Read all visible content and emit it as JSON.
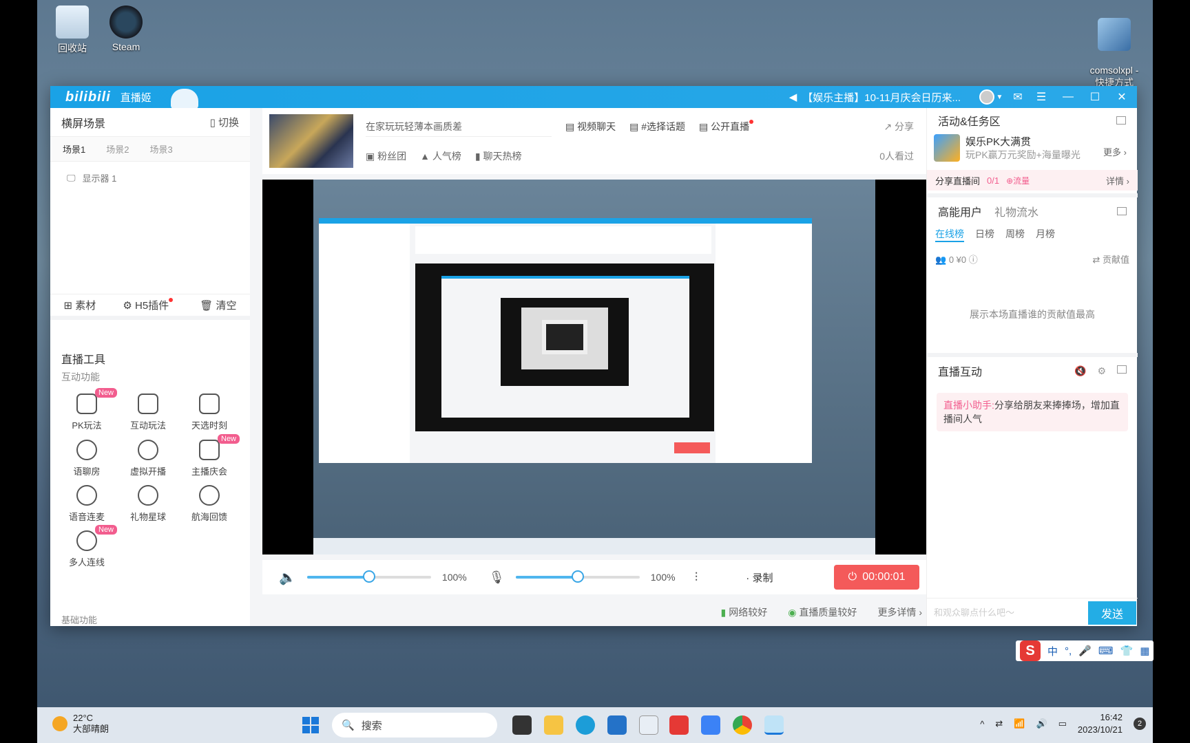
{
  "desktop": {
    "icons": [
      {
        "label": "回收站"
      },
      {
        "label": "Steam"
      },
      {
        "label": "comsolxpl -\n快捷方式"
      }
    ]
  },
  "titlebar": {
    "logo": "bilibili",
    "app_name": "直播姬",
    "notice": "【娱乐主播】10-11月庆会日历来...",
    "minimize": "—",
    "maximize": "☐",
    "close": "✕"
  },
  "left": {
    "scene_header": "横屏场景",
    "switch_label": "切换",
    "scene_tabs": [
      "场景1",
      "场景2",
      "场景3"
    ],
    "source_item": "显示器 1",
    "material_label": "素材",
    "h5_label": "H5插件",
    "clear_label": "清空",
    "tools_title": "直播工具",
    "interact_title": "互动功能",
    "tools": [
      {
        "label": "PK玩法",
        "new": "New"
      },
      {
        "label": "互动玩法",
        "new": ""
      },
      {
        "label": "天选时刻",
        "new": ""
      },
      {
        "label": "语聊房",
        "new": ""
      },
      {
        "label": "虚拟开播",
        "new": ""
      },
      {
        "label": "主播庆会",
        "new": "New"
      },
      {
        "label": "语音连麦",
        "new": ""
      },
      {
        "label": "礼物星球",
        "new": ""
      },
      {
        "label": "航海回馈",
        "new": ""
      },
      {
        "label": "多人连线",
        "new": "New"
      }
    ],
    "basic_title": "基础功能"
  },
  "center": {
    "room_title": "在家玩玩轻薄本画质差",
    "category": "视频聊天",
    "topic": "#选择话题",
    "public_live": "公开直播",
    "share": "分享",
    "fan_group": "粉丝团",
    "popularity": "人气榜",
    "chat_hot": "聊天热榜",
    "viewers": "0人看过",
    "speaker_pct": "100%",
    "mic_pct": "100%",
    "speaker_level": 0.5,
    "mic_level": 0.5,
    "record": "录制",
    "live_time": "00:00:01",
    "net_status": "网络较好",
    "quality_status": "直播质量较好",
    "more_details": "更多详情"
  },
  "right": {
    "activity_header": "活动&任务区",
    "activity_title": "娱乐PK大满贯",
    "activity_sub": "玩PK赢万元奖励+海量曝光",
    "more": "更多",
    "share_room": "分享直播间",
    "share_count": "0/1",
    "share_tag": "流量",
    "detail": "详情",
    "rank_tab1": "高能用户",
    "rank_tab2": "礼物流水",
    "period_tabs": [
      "在线榜",
      "日榜",
      "周榜",
      "月榜"
    ],
    "stats": "0 ¥0",
    "contribution": "贡献值",
    "rank_empty": "展示本场直播谁的贡献值最高",
    "interact_header": "直播互动",
    "helper_prefix": "直播小助手:",
    "helper_text": "分享给朋友来捧捧场，增加直播间人气",
    "chat_placeholder": "和观众聊点什么吧～",
    "send": "发送"
  },
  "ime": {
    "items": [
      "中",
      "°,",
      "🎤",
      "⌨",
      "👕",
      "▦"
    ]
  },
  "taskbar": {
    "temp": "22°C",
    "weather": "大部晴朗",
    "search": "搜索",
    "time": "16:42",
    "date": "2023/10/21",
    "notif_count": "2"
  }
}
